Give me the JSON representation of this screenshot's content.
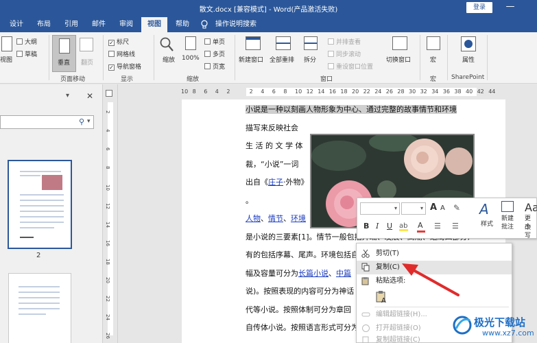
{
  "window": {
    "title": "散文.docx [兼容模式] - Word(产品激活失败)",
    "login_label": "登录",
    "minimize_glyph": "—"
  },
  "tabs": [
    "设计",
    "布局",
    "引用",
    "邮件",
    "审阅",
    "视图",
    "帮助",
    "操作说明搜索"
  ],
  "active_tab": "视图",
  "ribbon": {
    "views": {
      "read_mode": "视图",
      "outline": "大纲",
      "draft": "草稿"
    },
    "page_movement": {
      "vertical": "垂直",
      "side": "翻页",
      "group": "页面移动"
    },
    "show": {
      "ruler": "标尺",
      "gridlines": "网格线",
      "nav_pane": "导航窗格",
      "group": "显示",
      "ruler_checked": true,
      "gridlines_checked": false,
      "nav_checked": true
    },
    "zoom": {
      "zoom": "缩放",
      "percent": "100%",
      "one_page": "单页",
      "multi_page": "多页",
      "page_width": "页宽",
      "group": "缩放"
    },
    "window": {
      "new_window": "新建窗口",
      "arrange_all": "全部重排",
      "split": "拆分",
      "side_by_side": "并排查看",
      "sync_scroll": "同步滚动",
      "reset_pos": "重设窗口位置",
      "switch": "切换窗口",
      "group": "窗口"
    },
    "macros": {
      "label": "宏",
      "group": "宏"
    },
    "sharepoint": {
      "label": "属性",
      "group": "SharePoint"
    }
  },
  "nav": {
    "close_glyph": "✕",
    "dropdown_glyph": "▾",
    "search_glyph": "⚲",
    "search_caret": "▾",
    "page_number": "2"
  },
  "ruler_h": [
    "10",
    "8",
    "6",
    "4",
    "2",
    "",
    "2",
    "4",
    "6",
    "8",
    "10",
    "12",
    "14",
    "16",
    "18",
    "20",
    "22",
    "24",
    "26",
    "28",
    "30",
    "32",
    "34",
    "36",
    "38",
    "40",
    "42",
    "44"
  ],
  "ruler_v": [
    "2",
    "4",
    "6",
    "8",
    "10",
    "12",
    "14",
    "16",
    "18",
    "20",
    "22",
    "24",
    "26"
  ],
  "doc_lines": [
    {
      "parts": [
        {
          "t": "小说是一种以刻画人物形象为中心、通过完整的故事情节和环境",
          "hl": true
        }
      ]
    },
    {
      "parts": [
        {
          "t": "描写来反映社会",
          "hl": false
        }
      ]
    },
    {
      "parts": [
        {
          "t": "生 活 的 文 学 体",
          "hl": false
        }
      ]
    },
    {
      "parts": [
        {
          "t": "裁，“小说”一词",
          "hl": false
        }
      ]
    },
    {
      "parts": [
        {
          "t": "出自《",
          "hl": false
        },
        {
          "t": "庄子",
          "link": true
        },
        {
          "t": "·外物》",
          "hl": false
        }
      ]
    },
    {
      "parts": [
        {
          "t": "。",
          "hl": false
        }
      ]
    },
    {
      "parts": [
        {
          "t": "人物",
          "link": true
        },
        {
          "t": "、",
          "hl": false
        },
        {
          "t": "情节",
          "link": true
        },
        {
          "t": "、",
          "hl": false
        },
        {
          "t": "环境",
          "link": true
        }
      ]
    },
    {
      "parts": [
        {
          "t": "是小说的三要素[1]。情节一般包括开端、发展、高潮、结局四部分,",
          "hl": false
        }
      ]
    },
    {
      "parts": [
        {
          "t": "有的包括序幕、尾声。环境包括自",
          "hl": false
        }
      ]
    },
    {
      "parts": [
        {
          "t": "幅及容量可分为",
          "hl": false
        },
        {
          "t": "长篇小说",
          "link": true
        },
        {
          "t": "、",
          "hl": false
        },
        {
          "t": "中篇",
          "link": true
        }
      ]
    },
    {
      "parts": [
        {
          "t": "说)。按照表现的内容可分为神话",
          "hl": false
        }
      ]
    },
    {
      "parts": [
        {
          "t": "代等小说。按照体制可分为章回",
          "hl": false
        }
      ]
    },
    {
      "parts": [
        {
          "t": "自传体小说。按照语言形式可分为",
          "hl": false
        }
      ]
    }
  ],
  "mini_toolbar": {
    "bold": "B",
    "italic": "I",
    "underline": "U",
    "font_color": "A",
    "styles": "样式",
    "new_comment_1": "新建",
    "new_comment_2": "批注",
    "change_1": "更改",
    "change_2": "小写",
    "accent_color": "#e23d3d",
    "highlight_color": "#ffe34f"
  },
  "context_menu": {
    "items": [
      {
        "label": "剪切(T)",
        "disabled": false,
        "hover": false
      },
      {
        "label": "复制(C)",
        "disabled": false,
        "hover": true
      },
      {
        "label": "粘贴选项:",
        "disabled": false,
        "hover": false
      },
      {
        "label": "",
        "disabled": false,
        "hover": false
      },
      {
        "label": "编辑超链接(H)...",
        "disabled": true,
        "hover": false
      },
      {
        "label": "打开超链接(O)",
        "disabled": true,
        "hover": false
      },
      {
        "label": "复制超链接(C)",
        "disabled": true,
        "hover": false
      }
    ]
  },
  "watermark": {
    "brand": "极光下载站",
    "url": "www.xz7.com",
    "color": "#1f6fc6"
  },
  "colors": {
    "accent": "#2b579a",
    "arrow": "#e02b2b"
  }
}
